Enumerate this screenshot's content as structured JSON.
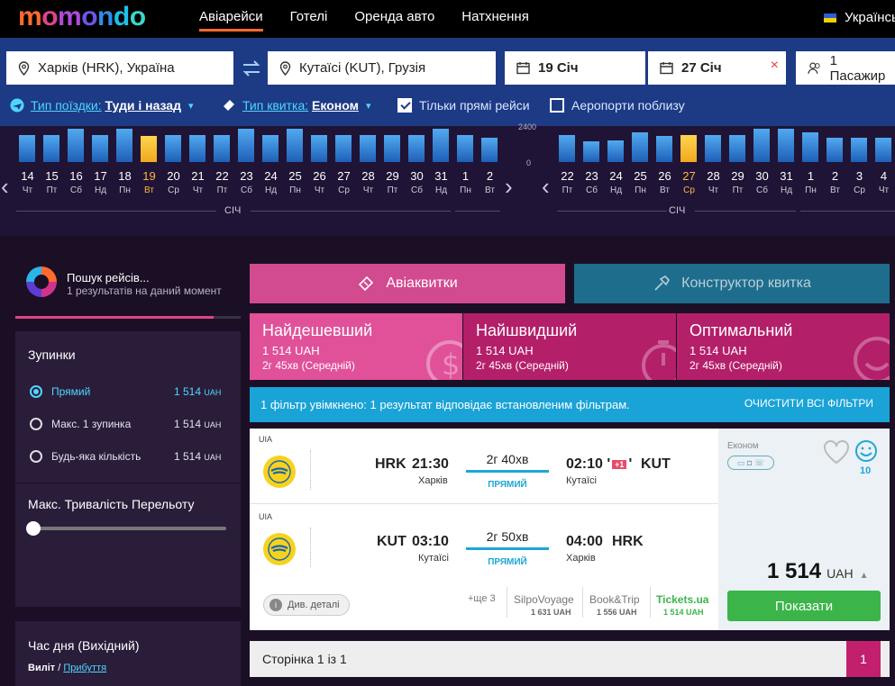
{
  "app": {
    "logo": "momondo"
  },
  "nav": {
    "items": [
      {
        "label": "Авіарейси",
        "active": true
      },
      {
        "label": "Готелі",
        "active": false
      },
      {
        "label": "Оренда авто",
        "active": false
      },
      {
        "label": "Натхнення",
        "active": false
      }
    ],
    "language": "Українськ"
  },
  "search": {
    "from": "Харків (HRK), Україна",
    "to": "Кутаїсі (KUT), Грузія",
    "depart_date": "19 Січ",
    "return_date": "27 Січ",
    "passengers": "1 Пасажир",
    "trip_type_label": "Тип поїздки:",
    "trip_type_value": "Туди і назад",
    "ticket_type_label": "Тип квитка:",
    "ticket_type_value": "Економ",
    "direct_only": "Тільки прямі рейси",
    "nearby_airports": "Аеропорти поблизу"
  },
  "calendar": {
    "month_label": "СІЧ",
    "y_max": "2400",
    "y_min": "0",
    "outbound": [
      {
        "day": "14",
        "dow": "Чт",
        "level": 0.82
      },
      {
        "day": "15",
        "dow": "Пт",
        "level": 0.82
      },
      {
        "day": "16",
        "dow": "Сб",
        "level": 1.0
      },
      {
        "day": "17",
        "dow": "Нд",
        "level": 0.82
      },
      {
        "day": "18",
        "dow": "Пн",
        "level": 1.0
      },
      {
        "day": "19",
        "dow": "Вт",
        "level": 0.78,
        "selected": true
      },
      {
        "day": "20",
        "dow": "Ср",
        "level": 0.82
      },
      {
        "day": "21",
        "dow": "Чт",
        "level": 0.82
      },
      {
        "day": "22",
        "dow": "Пт",
        "level": 0.82
      },
      {
        "day": "23",
        "dow": "Сб",
        "level": 1.0
      },
      {
        "day": "24",
        "dow": "Нд",
        "level": 0.82
      },
      {
        "day": "25",
        "dow": "Пн",
        "level": 1.0
      },
      {
        "day": "26",
        "dow": "Чт",
        "level": 0.82
      },
      {
        "day": "27",
        "dow": "Ср",
        "level": 0.82
      },
      {
        "day": "28",
        "dow": "Чт",
        "level": 0.82
      },
      {
        "day": "29",
        "dow": "Пт",
        "level": 0.82
      },
      {
        "day": "30",
        "dow": "Сб",
        "level": 0.82
      },
      {
        "day": "31",
        "dow": "Нд",
        "level": 1.0
      },
      {
        "day": "1",
        "dow": "Пн",
        "level": 0.82
      },
      {
        "day": "2",
        "dow": "Вт",
        "level": 0.72
      }
    ],
    "return": [
      {
        "day": "22",
        "dow": "Пт",
        "level": 0.82
      },
      {
        "day": "23",
        "dow": "Сб",
        "level": 0.62
      },
      {
        "day": "24",
        "dow": "Нд",
        "level": 0.65
      },
      {
        "day": "25",
        "dow": "Пн",
        "level": 0.9
      },
      {
        "day": "26",
        "dow": "Вт",
        "level": 0.78
      },
      {
        "day": "27",
        "dow": "Ср",
        "level": 0.8,
        "selected": true
      },
      {
        "day": "28",
        "dow": "Чт",
        "level": 0.82
      },
      {
        "day": "29",
        "dow": "Пт",
        "level": 0.82
      },
      {
        "day": "30",
        "dow": "Сб",
        "level": 1.0
      },
      {
        "day": "31",
        "dow": "Нд",
        "level": 1.0
      },
      {
        "day": "1",
        "dow": "Пн",
        "level": 0.9
      },
      {
        "day": "2",
        "dow": "Вт",
        "level": 0.72
      },
      {
        "day": "3",
        "dow": "Ср",
        "level": 0.72
      },
      {
        "day": "4",
        "dow": "Чт",
        "level": 0.72
      }
    ]
  },
  "status": {
    "title": "Пошук рейсів...",
    "subtitle": "1 результатів на даний момент",
    "progress": 0.88
  },
  "filters": {
    "stops_title": "Зупинки",
    "stops": [
      {
        "label": "Прямий",
        "price": "1 514",
        "currency": "UAH",
        "selected": true
      },
      {
        "label": "Макс. 1 зупинка",
        "price": "1 514",
        "currency": "UAH",
        "selected": false
      },
      {
        "label": "Будь-яка кількість",
        "price": "1 514",
        "currency": "UAH",
        "selected": false
      }
    ],
    "duration_title": "Макс. Тривалість Перельоту",
    "time_title": "Час дня (Вихідний)",
    "time_depart": "Виліт",
    "time_sep": "/",
    "time_arrive": "Прибуття"
  },
  "tabs": {
    "flights": "Авіаквитки",
    "builder": "Конструктор квитка"
  },
  "sort": [
    {
      "title": "Найдешевший",
      "price": "1 514 UAH",
      "duration": "2г 45хв (Середній)"
    },
    {
      "title": "Найшвидший",
      "price": "1 514 UAH",
      "duration": "2г 45хв (Середній)"
    },
    {
      "title": "Оптимальний",
      "price": "1 514 UAH",
      "duration": "2г 45хв (Середній)"
    }
  ],
  "filter_notice": {
    "text": "1 фільтр увімкнено: 1 результат відповідає встановленим фільтрам.",
    "clear": "ОЧИСТИТИ ВСІ ФІЛЬТРИ"
  },
  "result": {
    "legs": [
      {
        "airline": "UIA",
        "from_code": "HRK",
        "dep": "21:30",
        "from_city": "Харків",
        "duration": "2г 40хв",
        "stops": "ПРЯМИЙ",
        "arr": "02:10",
        "plus": "+1",
        "to_code": "KUT",
        "to_city": "Кутаїсі"
      },
      {
        "airline": "UIA",
        "from_code": "KUT",
        "dep": "03:10",
        "from_city": "Кутаїсі",
        "duration": "2г 50хв",
        "stops": "ПРЯМИЙ",
        "arr": "04:00",
        "plus": "",
        "to_code": "HRK",
        "to_city": "Харків"
      }
    ],
    "cabin": "Економ",
    "score": "10",
    "details": "Див. деталі",
    "more": "+ще 3",
    "providers": [
      {
        "name": "SilpoVoyage",
        "price": "1 631 UAH"
      },
      {
        "name": "Book&Trip",
        "price": "1 556 UAH"
      },
      {
        "name": "Tickets.ua",
        "price": "1 514 UAH"
      }
    ],
    "price": "1 514",
    "currency": "UAH",
    "cta": "Показати"
  },
  "pager": {
    "text": "Сторінка 1 із 1",
    "current": "1"
  },
  "colors": {
    "topbar": "#000000",
    "search_bg": "#1d3a85",
    "accent_cyan": "#4fd6ff",
    "pink": "#d24a8f",
    "teal": "#1e6d8c",
    "green": "#3bb54a"
  }
}
